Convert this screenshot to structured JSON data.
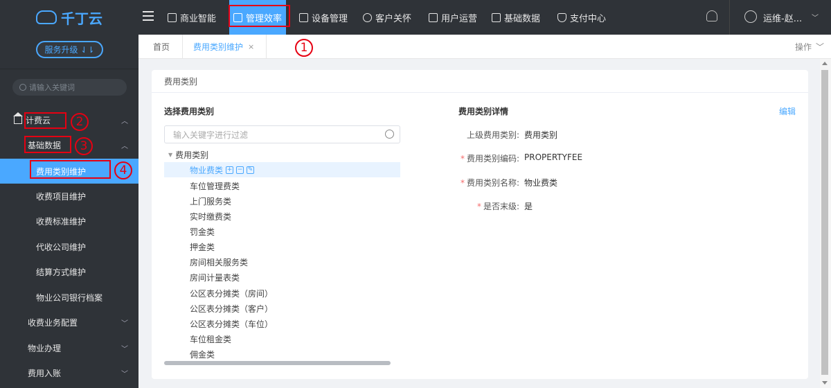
{
  "brand": {
    "name": "千丁云",
    "upgrade_label": "服务升级 ⇃⇂"
  },
  "sidebar": {
    "search_placeholder": "请输入关键词",
    "items": [
      {
        "label": "计费云"
      },
      {
        "label": "基础数据"
      },
      {
        "label": "费用类别维护"
      },
      {
        "label": "收费项目维护"
      },
      {
        "label": "收费标准维护"
      },
      {
        "label": "代收公司维护"
      },
      {
        "label": "结算方式维护"
      },
      {
        "label": "物业公司银行档案"
      },
      {
        "label": "收费业务配置"
      },
      {
        "label": "物业办理"
      },
      {
        "label": "费用入账"
      }
    ]
  },
  "topnav": {
    "items": [
      {
        "label": "商业智能"
      },
      {
        "label": "管理效率"
      },
      {
        "label": "设备管理"
      },
      {
        "label": "客户关怀"
      },
      {
        "label": "用户运营"
      },
      {
        "label": "基础数据"
      },
      {
        "label": "支付中心"
      }
    ],
    "user_name": "运维-赵..."
  },
  "tabs": {
    "home": "首页",
    "current": "费用类别维护",
    "close": "×",
    "ops": "操作"
  },
  "card": {
    "header": "费用类别",
    "left_title": "选择费用类别",
    "filter_placeholder": "输入关键字进行过滤",
    "tree_root": "费用类别",
    "tree_items": [
      "物业费类",
      "车位管理费类",
      "上门服务类",
      "实时缴费类",
      "罚金类",
      "押金类",
      "房间相关服务类",
      "房间计量表类",
      "公区表分摊类（房间）",
      "公区表分摊类（客户）",
      "公区表分摊类（车位）",
      "车位租金类",
      "佣金类"
    ],
    "right_title": "费用类别详情",
    "edit_label": "编辑",
    "details": [
      {
        "label": "上级费用类别:",
        "value": "费用类别",
        "required": false
      },
      {
        "label": "费用类别编码:",
        "value": "PROPERTYFEE",
        "required": true
      },
      {
        "label": "费用类别名称:",
        "value": "物业费类",
        "required": true
      },
      {
        "label": "是否末级:",
        "value": "是",
        "required": true
      }
    ]
  },
  "annotations": [
    "1",
    "2",
    "3",
    "4"
  ],
  "colors": {
    "accent": "#4aa8ff",
    "sidebar_bg": "#2f3338",
    "annotation": "#e60012"
  }
}
